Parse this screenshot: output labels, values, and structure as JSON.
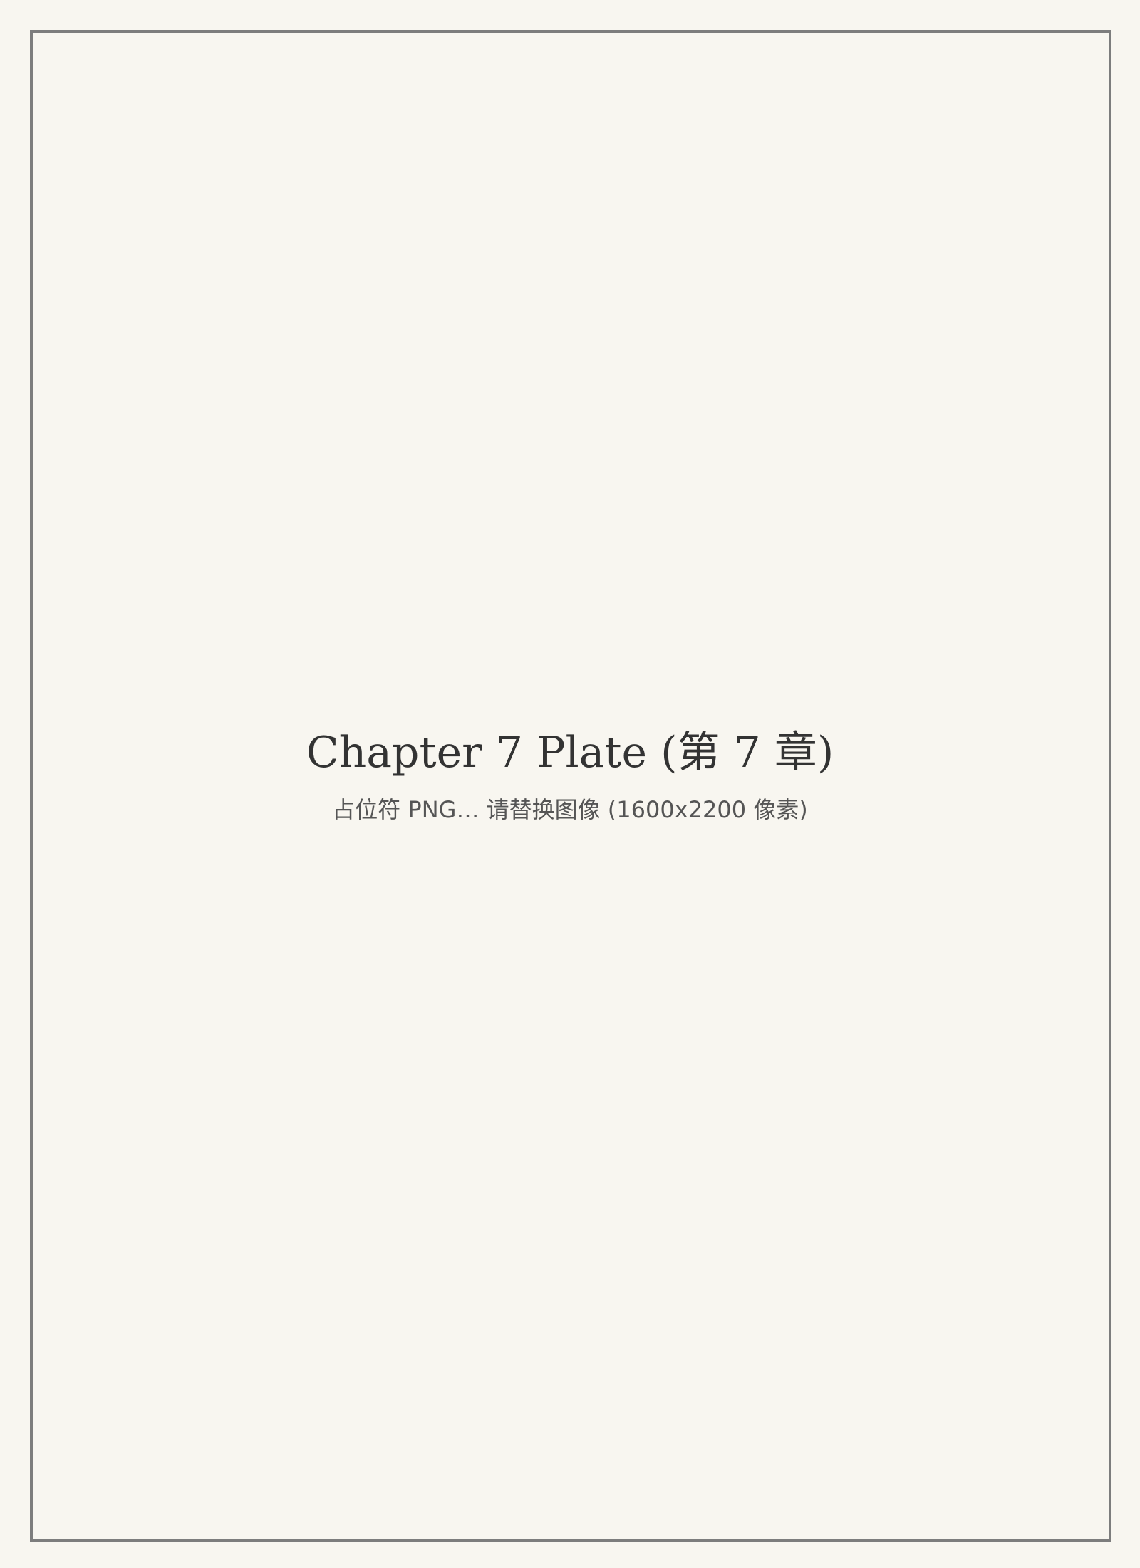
{
  "plate": {
    "title": "Chapter 7 Plate (第 7 章)",
    "subtitle": "占位符 PNG… 请替换图像 (1600x2200 像素)"
  },
  "colors": {
    "background": "#f8f6f0",
    "border": "#7d7d7d",
    "title_text": "#333333",
    "subtitle_text": "#555555"
  }
}
